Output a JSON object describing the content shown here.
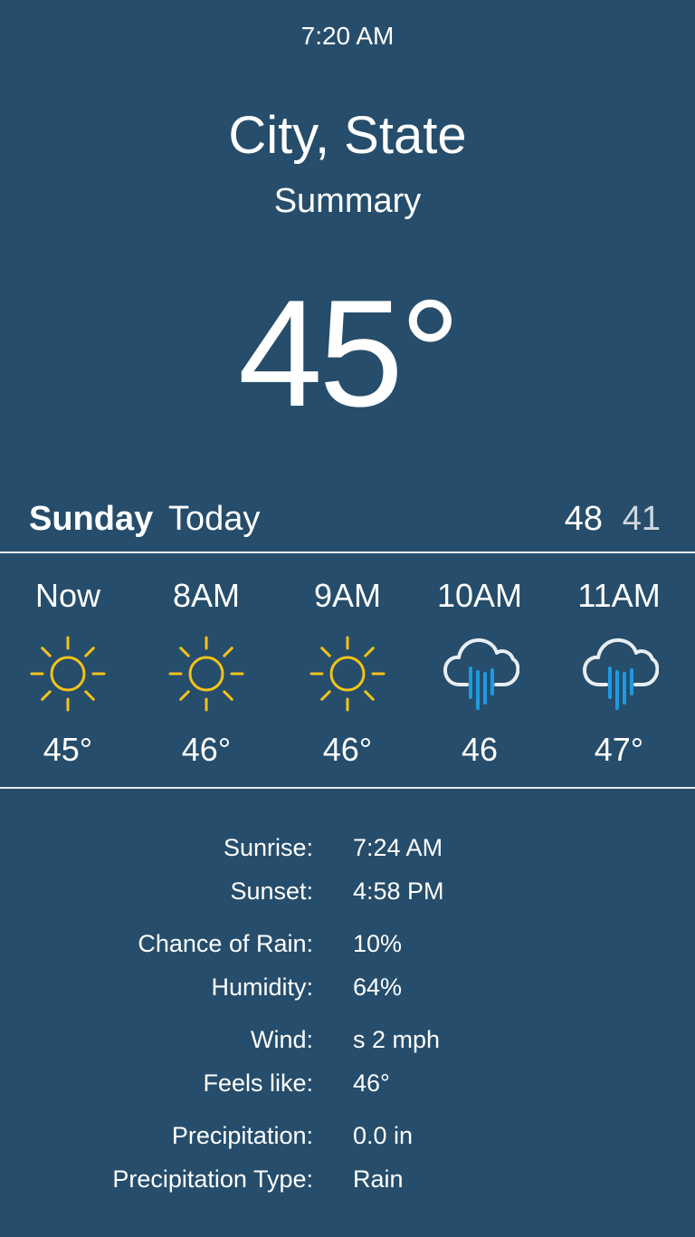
{
  "status_bar": {
    "time": "7:20 AM"
  },
  "header": {
    "location": "City, State",
    "summary": "Summary",
    "current_temp": "45°"
  },
  "day": {
    "name": "Sunday",
    "label": "Today",
    "high": "48",
    "low": "41"
  },
  "hourly": [
    {
      "time": "Now",
      "icon": "sun-icon",
      "temp": "45°"
    },
    {
      "time": "8AM",
      "icon": "sun-icon",
      "temp": "46°"
    },
    {
      "time": "9AM",
      "icon": "sun-icon",
      "temp": "46°"
    },
    {
      "time": "10AM",
      "icon": "cloud-rain-icon",
      "temp": "46"
    },
    {
      "time": "11AM",
      "icon": "cloud-rain-icon",
      "temp": "47°"
    }
  ],
  "details": [
    {
      "label": "Sunrise:",
      "value": "7:24 AM"
    },
    {
      "label": "Sunset:",
      "value": "4:58 PM"
    },
    {
      "label": "Chance of Rain:",
      "value": "10%"
    },
    {
      "label": "Humidity:",
      "value": "64%"
    },
    {
      "label": "Wind:",
      "value": "s 2 mph"
    },
    {
      "label": "Feels like:",
      "value": "46°"
    },
    {
      "label": "Precipitation:",
      "value": "0.0 in"
    },
    {
      "label": "Precipitation Type:",
      "value": "Rain"
    }
  ],
  "colors": {
    "background": "#264d6b",
    "text": "#ffffff",
    "sun": "#f2c318",
    "rain": "#1e9ae0",
    "cloud_stroke": "#e8eef2"
  }
}
